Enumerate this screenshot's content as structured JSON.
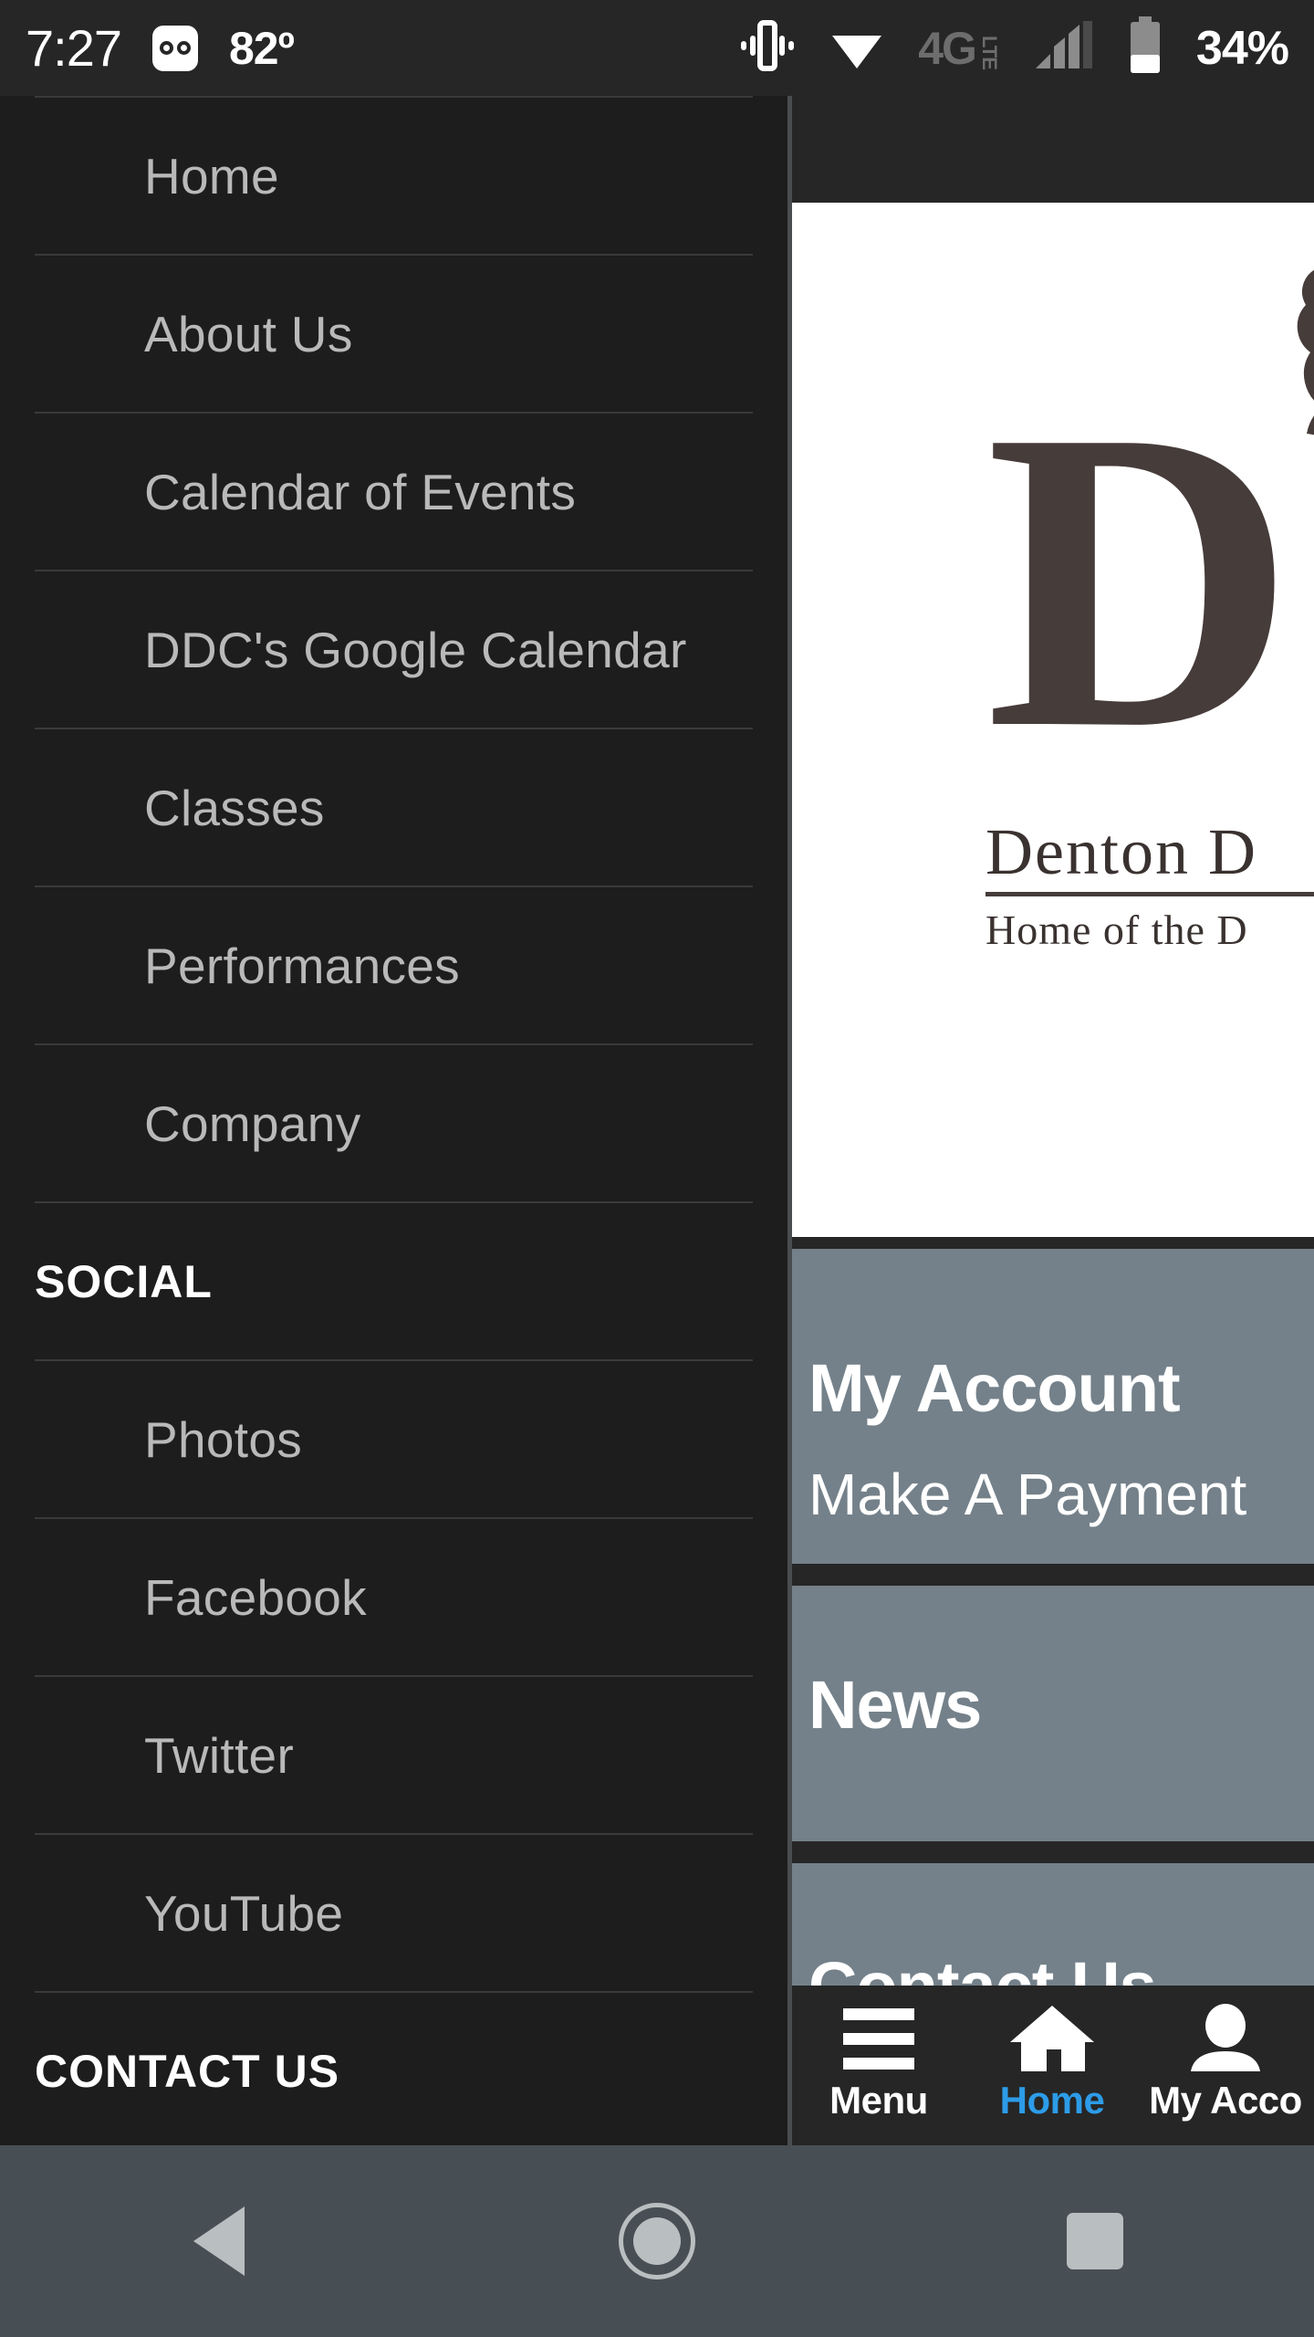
{
  "status_bar": {
    "time": "7:27",
    "voicemail_icon": "voicemail-icon",
    "temperature": "82º",
    "vibrate_icon": "vibrate-icon",
    "wifi_icon": "wifi-icon",
    "network_type": "4G",
    "network_suffix": "LTE",
    "signal_icon": "signal-bars-icon",
    "battery_icon": "battery-icon",
    "battery_percent": "34%"
  },
  "sidebar": {
    "items": [
      {
        "label": "Home"
      },
      {
        "label": "About Us"
      },
      {
        "label": "Calendar of Events"
      },
      {
        "label": "DDC's Google Calendar"
      },
      {
        "label": "Classes"
      },
      {
        "label": "Performances"
      },
      {
        "label": "Company"
      }
    ],
    "social_heading": "SOCIAL",
    "social_items": [
      {
        "label": "Photos"
      },
      {
        "label": "Facebook"
      },
      {
        "label": "Twitter"
      },
      {
        "label": "YouTube"
      }
    ],
    "contact_heading": "CONTACT US"
  },
  "content": {
    "logo": {
      "letter": "D",
      "name": "Denton D",
      "tagline": "Home of the D",
      "silhouette_icon": "dancer-silhouette-icon",
      "color": "#463c3a"
    },
    "cards": [
      {
        "title": "My Account",
        "subtitle": "Make A Payment"
      },
      {
        "title": "News",
        "subtitle": ""
      },
      {
        "title": "Contact Us",
        "subtitle": ""
      }
    ],
    "card_color": "#74818a"
  },
  "tabbar": {
    "accent_color": "#2d9ce8",
    "tabs": [
      {
        "label": "Menu",
        "icon": "hamburger-menu-icon",
        "active": false
      },
      {
        "label": "Home",
        "icon": "house-icon",
        "active": true
      },
      {
        "label": "My Acco",
        "icon": "person-icon",
        "active": false
      }
    ]
  },
  "android_nav": {
    "back": "back-button",
    "home": "home-button",
    "recents": "recents-button"
  }
}
